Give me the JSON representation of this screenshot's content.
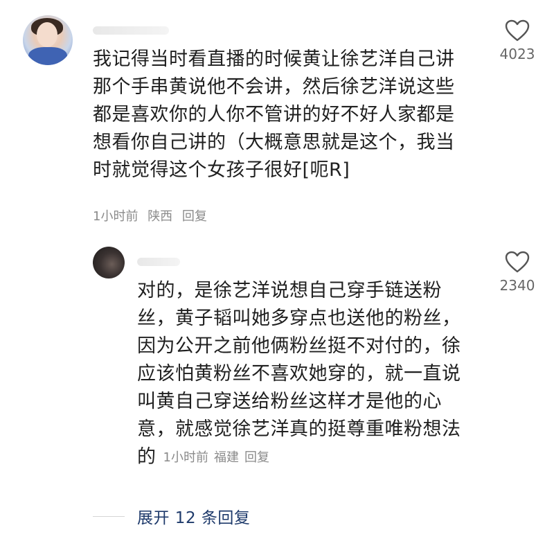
{
  "comment": {
    "lines": [
      "我记得当时看直播的时候黄让徐艺洋自己讲",
      "那个手串黄说他不会讲，然后徐艺洋说这些",
      "都是喜欢你的人你不管讲的好不好人家都是",
      "想看你自己讲的（大概意思就是这个，我当",
      "时就觉得这个女孩子很好[呃R]"
    ],
    "time": "1小时前",
    "location": "陕西",
    "reply_label": "回复",
    "like_count": "4023",
    "like_icon": "heart-outline-icon"
  },
  "reply": {
    "lines": [
      "对的，是徐艺洋说想自己穿手链送粉",
      "丝，黄子韬叫她多穿点也送他的粉丝，",
      "因为公开之前他俩粉丝挺不对付的，徐",
      "应该怕黄粉丝不喜欢她穿的，就一直说",
      "叫黄自己穿送给粉丝这样才是他的心",
      "意，就感觉徐艺洋真的挺尊重唯粉想法",
      "的"
    ],
    "time": "1小时前",
    "location": "福建",
    "reply_label": "回复",
    "like_count": "2340",
    "like_icon": "heart-outline-icon"
  },
  "expand": {
    "label": "展开 12 条回复"
  },
  "colors": {
    "text": "#1f1f1f",
    "meta": "#8a8a8a",
    "link": "#1e3a6b"
  }
}
